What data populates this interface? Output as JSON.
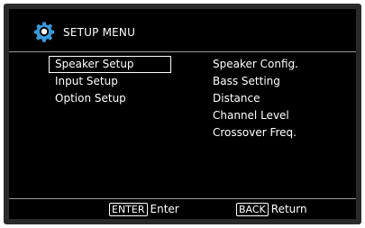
{
  "header": {
    "title": "SETUP MENU",
    "icon": "gear-icon",
    "icon_color": "#3a9ad9"
  },
  "menu": {
    "items": [
      {
        "label": "Speaker Setup",
        "selected": true
      },
      {
        "label": "Input Setup",
        "selected": false
      },
      {
        "label": "Option Setup",
        "selected": false
      }
    ]
  },
  "submenu": {
    "items": [
      {
        "label": "Speaker Config."
      },
      {
        "label": "Bass Setting"
      },
      {
        "label": "Distance"
      },
      {
        "label": "Channel Level"
      },
      {
        "label": "Crossover Freq."
      }
    ]
  },
  "footer": {
    "enter_key": "ENTER",
    "enter_label": "Enter",
    "back_key": "BACK",
    "back_label": "Return"
  }
}
